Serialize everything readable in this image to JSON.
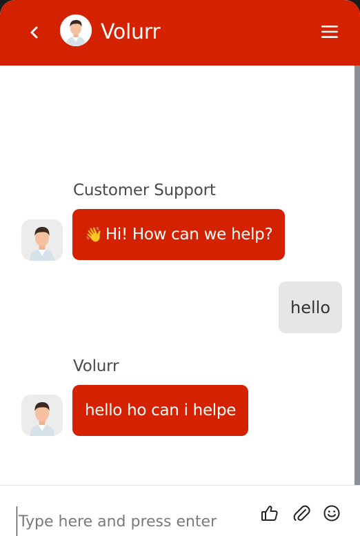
{
  "header": {
    "title": "Volurr",
    "back_icon": "chevron-left-icon",
    "menu_icon": "hamburger-menu-icon",
    "color": "#d42100"
  },
  "messages": [
    {
      "sender": "Customer Support",
      "text": "Hi! How can we help?",
      "emoji": "👋",
      "direction": "incoming"
    },
    {
      "text": "hello",
      "direction": "outgoing"
    },
    {
      "sender": "Volurr",
      "text": "hello ho can i helpe",
      "direction": "incoming"
    }
  ],
  "composer": {
    "placeholder": "Type here and press enter",
    "icons": [
      "thumbs-up-icon",
      "paperclip-icon",
      "emoji-icon"
    ]
  },
  "colors": {
    "accent": "#d42100",
    "outgoing_bubble": "#e6e6e6"
  }
}
